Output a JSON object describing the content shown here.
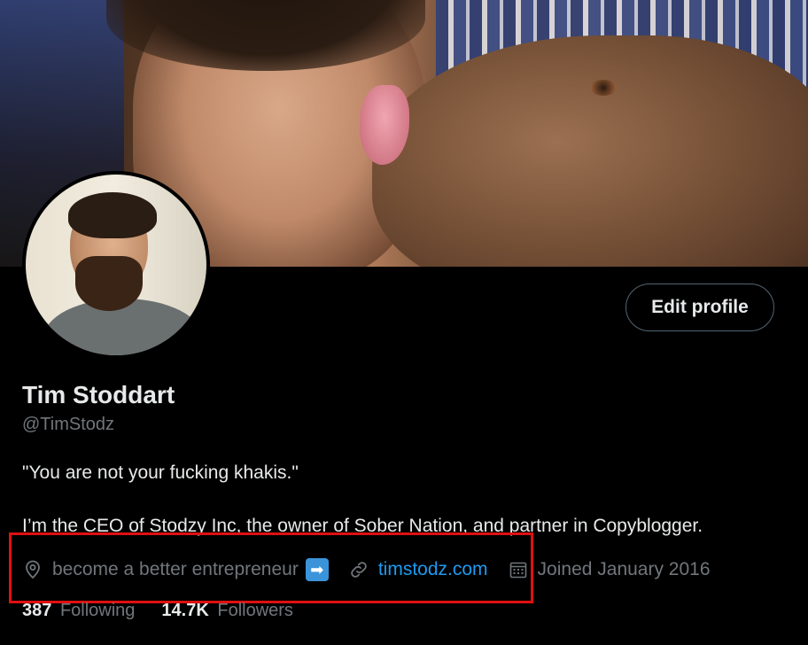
{
  "profile": {
    "name": "Tim Stoddart",
    "handle": "@TimStodz",
    "bio_line1": "\"You are not your fucking khakis.\"",
    "bio_line2": "I’m the CEO of Stodzy Inc, the owner of Sober Nation, and partner in Copyblogger.",
    "location": "become a better entrepreneur",
    "location_emoji": "➡",
    "website": "timstodz.com",
    "joined": "Joined January 2016",
    "following_count": "387",
    "following_label": "Following",
    "followers_count": "14.7K",
    "followers_label": "Followers"
  },
  "actions": {
    "edit_profile_label": "Edit profile"
  },
  "icons": {
    "location": "location-pin-icon",
    "link": "link-icon",
    "calendar": "calendar-icon"
  },
  "colors": {
    "background": "#000000",
    "primary_text": "#e7e9ea",
    "secondary_text": "#71767b",
    "link": "#1d9bf0",
    "highlight_box": "#e01010"
  }
}
